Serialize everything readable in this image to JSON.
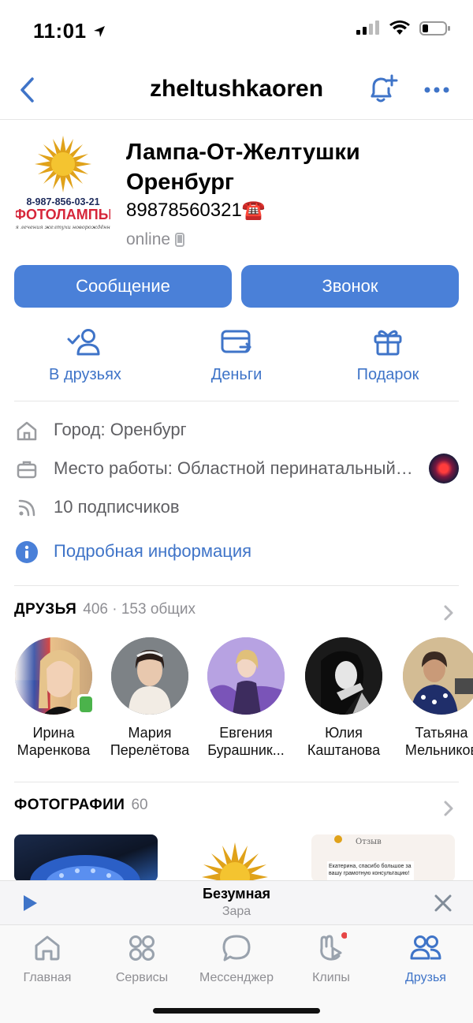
{
  "status_bar": {
    "time": "11:01"
  },
  "nav": {
    "title": "zheltushkaoren"
  },
  "profile": {
    "name": "Лампа-От-Желтушки Оренбург",
    "phone": "89878560321",
    "phone_emoji": "☎️",
    "status": "online",
    "logo_phone": "8-987-856-03-21",
    "logo_brand": "ФОТОЛАМПЫ",
    "logo_tagline": "для лечения желтухи новорождённых"
  },
  "buttons": {
    "message": "Сообщение",
    "call": "Звонок"
  },
  "actions": [
    {
      "label": "В друзьях",
      "icon": "friend-check-icon"
    },
    {
      "label": "Деньги",
      "icon": "money-card-icon"
    },
    {
      "label": "Подарок",
      "icon": "gift-icon"
    }
  ],
  "info": {
    "city": "Город: Оренбург",
    "work": "Место работы: Областной перинатальный центр",
    "subscribers": "10 подписчиков",
    "more": "Подробная информация"
  },
  "friends_section": {
    "title": "ДРУЗЬЯ",
    "count": "406 · 153 общих"
  },
  "friends": [
    {
      "first": "Ирина",
      "last": "Маренкова"
    },
    {
      "first": "Мария",
      "last": "Перелётова"
    },
    {
      "first": "Евгения",
      "last": "Бурашник..."
    },
    {
      "first": "Юлия",
      "last": "Каштанова"
    },
    {
      "first": "Татьяна",
      "last": "Мельников"
    }
  ],
  "photos_section": {
    "title": "ФОТОГРАФИИ",
    "count": "60"
  },
  "photos": {
    "review_title": "Отзыв",
    "review_text": "Екатерина, спасибо большое за вашу грамотную консультацию!"
  },
  "player": {
    "title": "Безумная",
    "artist": "Зара"
  },
  "tabs": [
    {
      "label": "Главная",
      "icon": "home-icon"
    },
    {
      "label": "Сервисы",
      "icon": "services-icon"
    },
    {
      "label": "Мессенджер",
      "icon": "messenger-icon"
    },
    {
      "label": "Клипы",
      "icon": "clips-icon"
    },
    {
      "label": "Друзья",
      "icon": "friends-icon",
      "active": true
    }
  ],
  "colors": {
    "accent": "#4a80d8",
    "link": "#3f74c8",
    "secondary": "#8e8e93",
    "online": "#4bb34b",
    "badge": "#e64646"
  }
}
